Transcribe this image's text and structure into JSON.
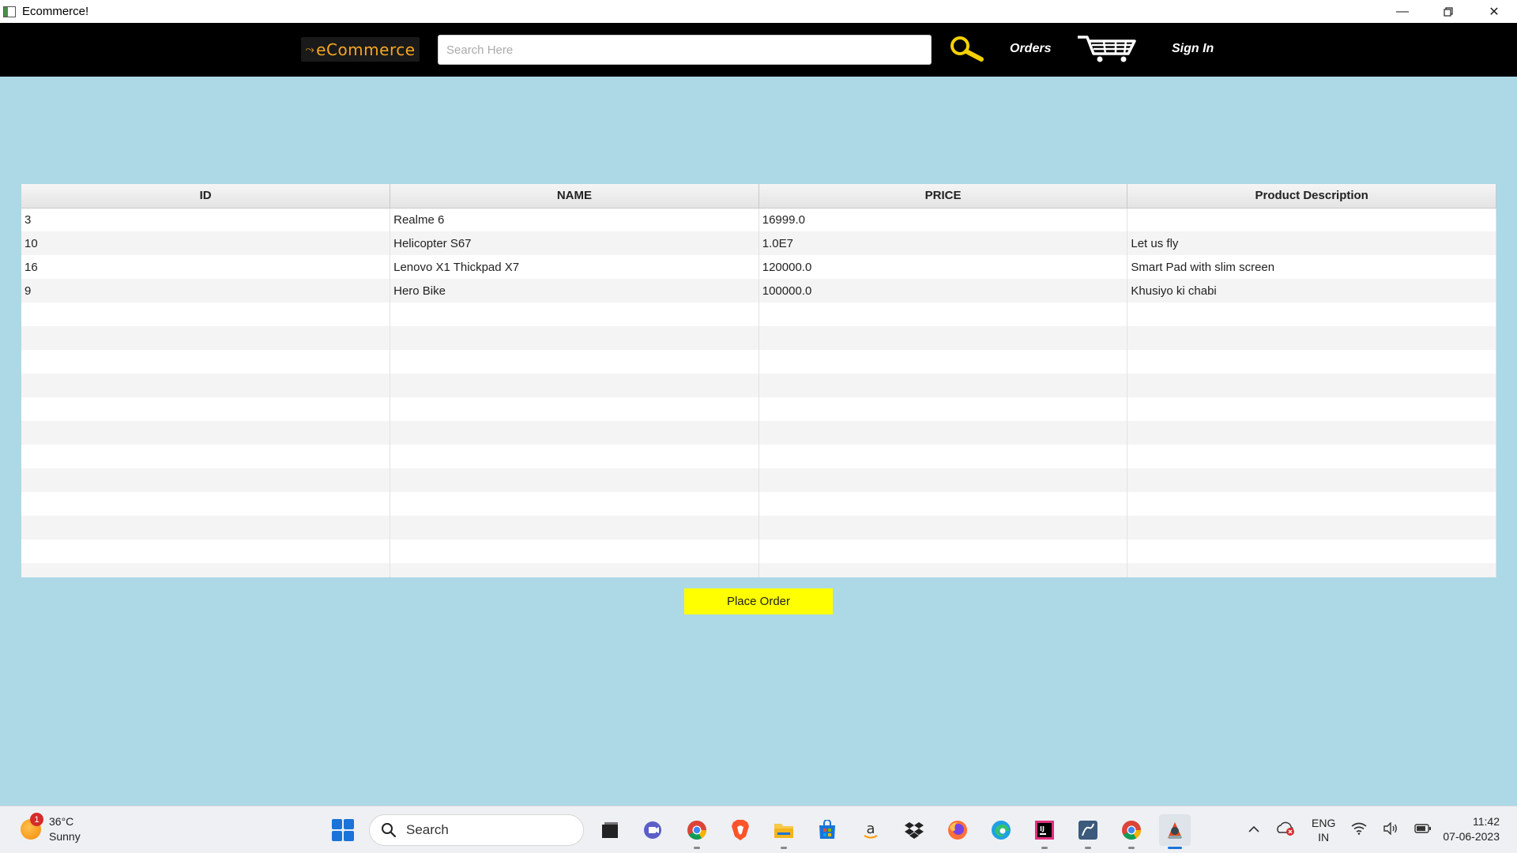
{
  "window": {
    "title": "Ecommerce!"
  },
  "navbar": {
    "logo_text": "eCommerce",
    "search": {
      "placeholder": "Search Here",
      "value": ""
    },
    "orders_label": "Orders",
    "signin_label": "Sign In",
    "accent_color": "#f5d000"
  },
  "table": {
    "columns": [
      "ID",
      "NAME",
      "PRICE",
      "Product Description"
    ],
    "rows": [
      [
        "3",
        "Realme 6",
        "16999.0",
        ""
      ],
      [
        "10",
        "Helicopter S67",
        "1.0E7",
        "Let us fly"
      ],
      [
        "16",
        "Lenovo X1 Thickpad X7",
        "120000.0",
        "Smart Pad with slim screen"
      ],
      [
        "9",
        "Hero Bike",
        "100000.0",
        "Khusiyo ki chabi"
      ]
    ]
  },
  "place_order_label": "Place Order",
  "taskbar": {
    "weather": {
      "temp": "36°C",
      "condition": "Sunny",
      "badge": "1"
    },
    "search_label": "Search",
    "apps": [
      "file-explorer-dark",
      "teams",
      "chrome",
      "brave",
      "file-explorer",
      "microsoft-store",
      "amazon",
      "dropbox",
      "firefox",
      "edge",
      "intellij",
      "mysql-workbench",
      "chrome-profile",
      "java-app"
    ],
    "language": {
      "line1": "ENG",
      "line2": "IN"
    },
    "time": "11:42",
    "date": "07-06-2023"
  },
  "colors": {
    "background": "#add8e6",
    "navbar": "#000000",
    "button": "#ffff00"
  }
}
